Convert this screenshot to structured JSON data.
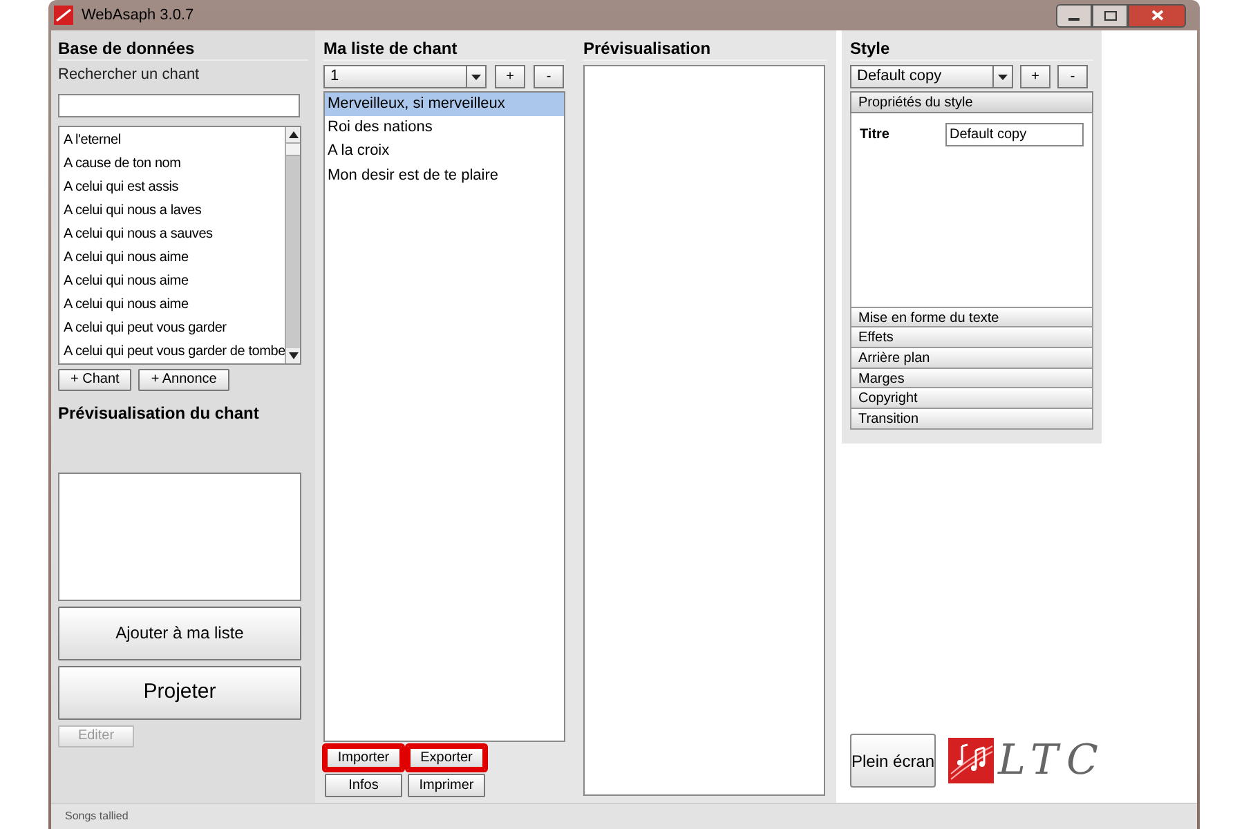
{
  "window": {
    "title": "WebAsaph 3.0.7"
  },
  "database": {
    "heading": "Base de données",
    "search_label": "Rechercher un chant",
    "songs": [
      {
        "title": "A l'eternel"
      },
      {
        "title": "A cause de ton nom"
      },
      {
        "title": "A celui qui est assis"
      },
      {
        "title": "A celui qui nous a laves"
      },
      {
        "title": "A celui qui nous a sauves"
      },
      {
        "title": "A celui qui nous aime"
      },
      {
        "title": "A celui qui nous aime"
      },
      {
        "title": "A celui qui nous aime"
      },
      {
        "title": "A celui qui peut vous garder"
      },
      {
        "title": "A celui qui peut vous garder de tombe"
      }
    ],
    "add_buttons": [
      "+ Chant",
      "+ Annonce"
    ],
    "preview_heading": "Prévisualisation du chant",
    "actions": [
      {
        "label": "Ajouter à ma liste",
        "kind": "large",
        "disabled": false
      },
      {
        "label": "Projeter",
        "kind": "huge",
        "disabled": false
      },
      {
        "label": "Editer",
        "kind": "small",
        "disabled": true
      }
    ]
  },
  "setlist": {
    "heading": "Ma liste de chant",
    "selector": "1",
    "add": "+",
    "remove": "-",
    "items": [
      {
        "title": "Merveilleux, si merveilleux",
        "selected": true
      },
      {
        "title": "Roi des nations",
        "selected": false
      },
      {
        "title": "A la croix",
        "selected": false
      },
      {
        "title": "Mon desir est de te plaire",
        "selected": false
      }
    ],
    "buttons": [
      {
        "label": "Importer",
        "highlighted": true
      },
      {
        "label": "Exporter",
        "highlighted": true
      },
      {
        "label": "Infos",
        "highlighted": false
      },
      {
        "label": "Imprimer",
        "highlighted": false
      }
    ]
  },
  "preview": {
    "heading": "Prévisualisation"
  },
  "style": {
    "heading": "Style",
    "selector": "Default copy",
    "add": "+",
    "remove": "-",
    "sections": [
      {
        "label": "Propriétés du style",
        "expanded": true,
        "fields": [
          {
            "label": "Titre",
            "value": "Default copy"
          }
        ]
      },
      {
        "label": "Mise en forme du texte",
        "expanded": false
      },
      {
        "label": "Effets",
        "expanded": false
      },
      {
        "label": "Arrière plan",
        "expanded": false
      },
      {
        "label": "Marges",
        "expanded": false
      },
      {
        "label": "Copyright",
        "expanded": false
      },
      {
        "label": "Transition",
        "expanded": false
      }
    ],
    "fullscreen_button": "Plein écran",
    "logo_text": "LTC"
  },
  "status_bar": {
    "text": "Songs tallied"
  }
}
